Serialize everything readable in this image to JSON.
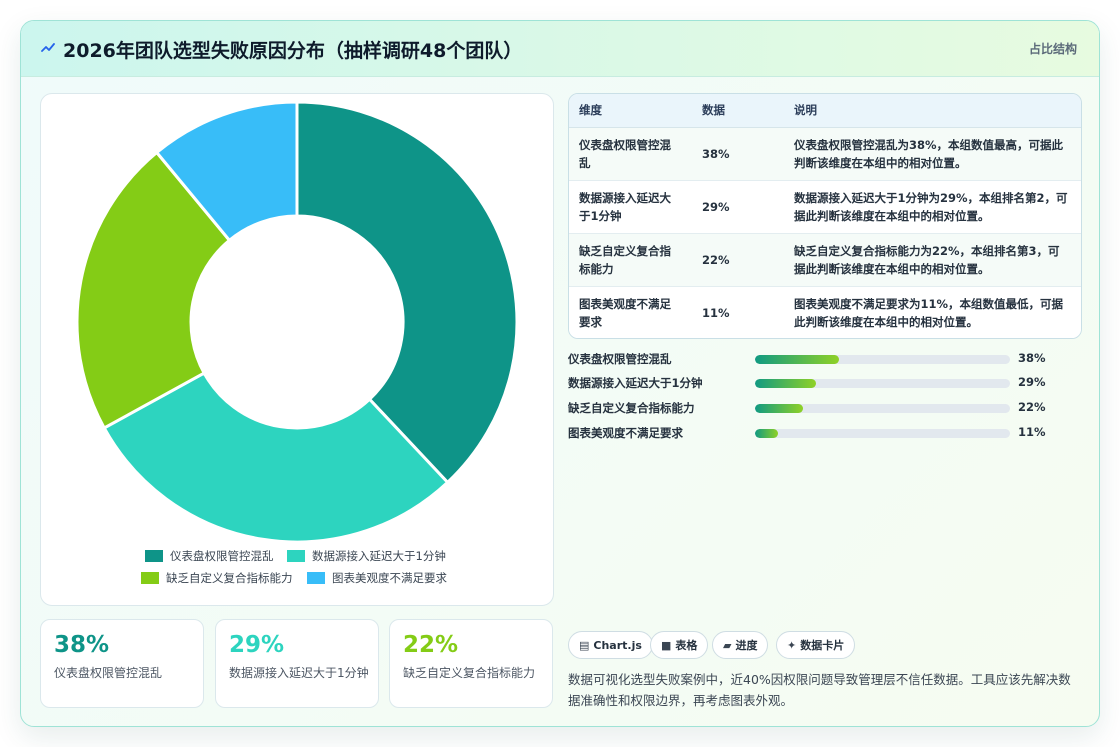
{
  "header": {
    "icon": "sparkline-icon",
    "title": "2026年团队选型失败原因分布（抽样调研48个团队）",
    "tag": "占比结构"
  },
  "colors": {
    "series": [
      "#0e9488",
      "#2dd4bf",
      "#84cc16",
      "#38bdf8"
    ],
    "accent": "#0e9488"
  },
  "chart_data": {
    "type": "pie",
    "donut": true,
    "categories": [
      "仪表盘权限管控混乱",
      "数据源接入延迟大于1分钟",
      "缺乏自定义复合指标能力",
      "图表美观度不满足要求"
    ],
    "values": [
      38,
      29,
      22,
      11
    ],
    "unit": "%",
    "legend": "bottom"
  },
  "table": {
    "headers": [
      "维度",
      "数据",
      "说明"
    ],
    "rows": [
      [
        "仪表盘权限管控混乱",
        "38%",
        "仪表盘权限管控混乱为38%，本组数值最高，可据此判断该维度在本组中的相对位置。"
      ],
      [
        "数据源接入延迟大于1分钟",
        "29%",
        "数据源接入延迟大于1分钟为29%，本组排名第2，可据此判断该维度在本组中的相对位置。"
      ],
      [
        "缺乏自定义复合指标能力",
        "22%",
        "缺乏自定义复合指标能力为22%，本组排名第3，可据此判断该维度在本组中的相对位置。"
      ],
      [
        "图表美观度不满足要求",
        "11%",
        "图表美观度不满足要求为11%，本组数值最低，可据此判断该维度在本组中的相对位置。"
      ]
    ]
  },
  "progress": [
    {
      "label": "仪表盘权限管控混乱",
      "percent": 33,
      "value_text": "38%"
    },
    {
      "label": "数据源接入延迟大于1分钟",
      "percent": 24,
      "value_text": "29%"
    },
    {
      "label": "缺乏自定义复合指标能力",
      "percent": 19,
      "value_text": "22%"
    },
    {
      "label": "图表美观度不满足要求",
      "percent": 9,
      "value_text": "11%"
    }
  ],
  "stats": [
    {
      "value": "38%",
      "label": "仪表盘权限管控混乱",
      "color": "#0e9488"
    },
    {
      "value": "29%",
      "label": "数据源接入延迟大于1分钟",
      "color": "#2dd4bf"
    },
    {
      "value": "22%",
      "label": "缺乏自定义复合指标能力",
      "color": "#84cc16"
    }
  ],
  "chips": [
    {
      "icon": "chart-icon",
      "glyph": "▤",
      "label": "Chart.js"
    },
    {
      "icon": "table-icon",
      "glyph": "■",
      "label": "表格"
    },
    {
      "icon": "progress-icon",
      "glyph": "▰",
      "label": "进度"
    },
    {
      "icon": "card-icon",
      "glyph": "✦",
      "label": "数据卡片"
    }
  ],
  "summary": "数据可视化选型失败案例中，近40%因权限问题导致管理层不信任数据。工具应该先解决数据准确性和权限边界，再考虑图表外观。"
}
